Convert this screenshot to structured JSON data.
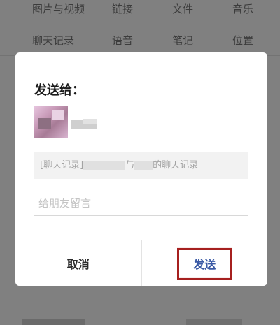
{
  "background": {
    "category_row_1": [
      "图片与视频",
      "链接",
      "文件",
      "音乐"
    ],
    "category_row_2": [
      "聊天记录",
      "语音",
      "笔记",
      "位置"
    ]
  },
  "dialog": {
    "title": "发送给：",
    "preview": {
      "prefix": "[聊天记录]",
      "middle": "与",
      "suffix": "的聊天记录"
    },
    "message_placeholder": "给朋友留言",
    "cancel_label": "取消",
    "send_label": "发送",
    "highlight_color": "#a6201f",
    "send_color": "#3b5aa5"
  }
}
